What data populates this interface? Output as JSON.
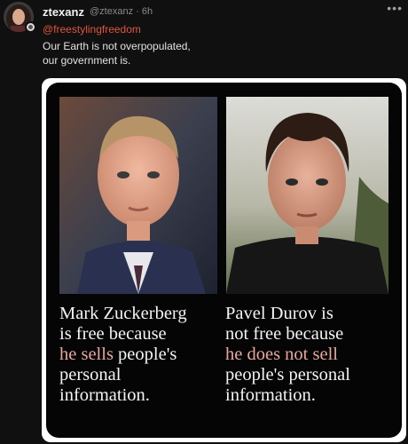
{
  "post": {
    "username": "ztexanz",
    "handle_time": "@ztexanz · 6h",
    "more_icon": "ellipsis-icon",
    "mention": "@freestylingfreedom",
    "body_lines": [
      "Our Earth is not overpopulated,",
      "our government is."
    ]
  },
  "meme": {
    "left_caption": {
      "l1": "Mark Zuckerberg",
      "l2": "is free because",
      "l3_hl": "he sells",
      "l3_rest": " people's",
      "l4": "personal",
      "l5": "information."
    },
    "right_caption": {
      "l1": "Pavel Durov is",
      "l2": "not free because",
      "l3_hl": "he does not sell",
      "l4": "people's personal",
      "l5": "information."
    },
    "highlight_color": "#e9a79f"
  }
}
